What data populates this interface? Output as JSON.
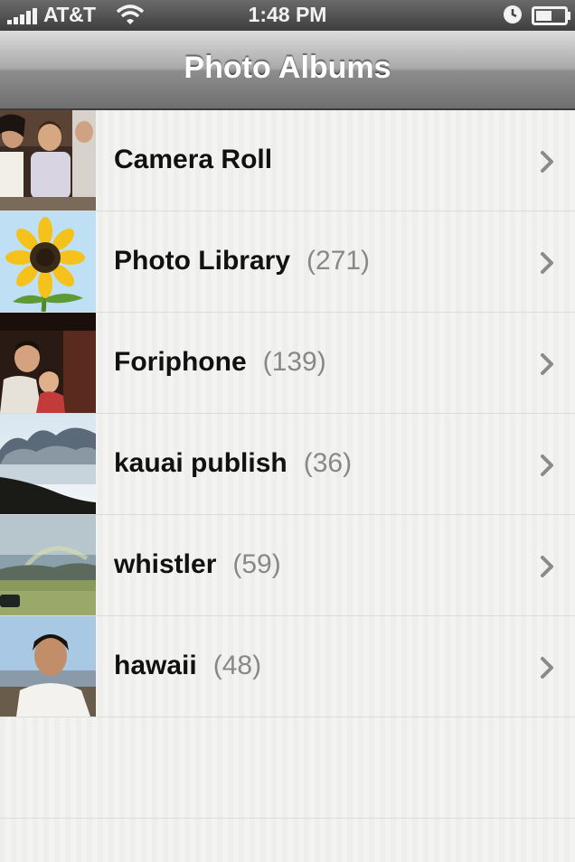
{
  "status_bar": {
    "carrier": "AT&T",
    "time": "1:48 PM"
  },
  "nav": {
    "title": "Photo Albums"
  },
  "albums": [
    {
      "name": "Camera Roll",
      "count": ""
    },
    {
      "name": "Photo Library",
      "count": "(271)"
    },
    {
      "name": "Foriphone",
      "count": "(139)"
    },
    {
      "name": "kauai publish",
      "count": "(36)"
    },
    {
      "name": "whistler",
      "count": "(59)"
    },
    {
      "name": "hawaii",
      "count": "(48)"
    }
  ],
  "icons": {
    "signal": "signal-strength-icon",
    "wifi": "wifi-icon",
    "alarm": "alarm-clock-icon",
    "battery": "battery-icon",
    "chevron": "chevron-right-icon"
  },
  "colors": {
    "nav_bar": "#8d8d8d",
    "count_text": "#888888",
    "chevron": "#8a8a8a"
  }
}
